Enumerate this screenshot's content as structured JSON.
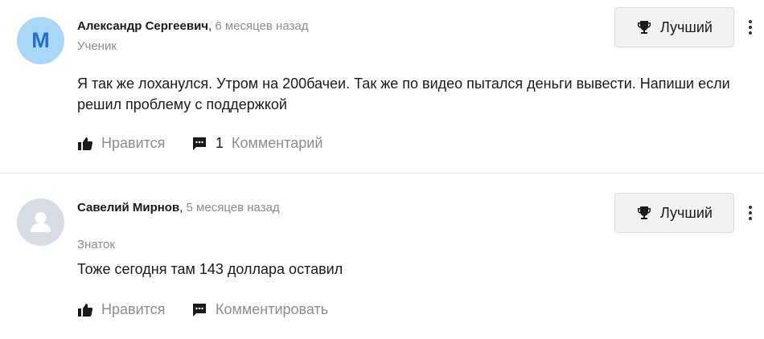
{
  "answers": [
    {
      "avatar_letter": "M",
      "author": "Александр Сергеевич",
      "separator": ",",
      "time": "6 месяцев назад",
      "rank": "Ученик",
      "best_label": "Лучший",
      "text": "Я так же лоханулся. Утром на 200бачеи. Так же по видео пытался деньги вывести. Напиши если решил проблему с поддержкой",
      "like_label": "Нравится",
      "comment_count": "1",
      "comment_label": "Комментарий"
    },
    {
      "avatar_letter": "",
      "author": "Савелий Мирнов",
      "separator": ",",
      "time": "5 месяцев назад",
      "rank": "Знаток",
      "best_label": "Лучший",
      "text": "Тоже сегодня там 143 доллара оставил",
      "like_label": "Нравится",
      "comment_label": "Комментировать"
    }
  ],
  "icons": {
    "trophy": "trophy-icon",
    "like": "thumbs-up-icon",
    "comment": "comment-bubble-icon",
    "more": "more-vertical-icon",
    "default_avatar": "user-silhouette-icon"
  },
  "colors": {
    "avatar_blue_bg": "#a9d7f7",
    "avatar_letter": "#1f6fd8",
    "avatar_gray_bg": "#d7dbe3",
    "muted_text": "#8c8c8c"
  }
}
